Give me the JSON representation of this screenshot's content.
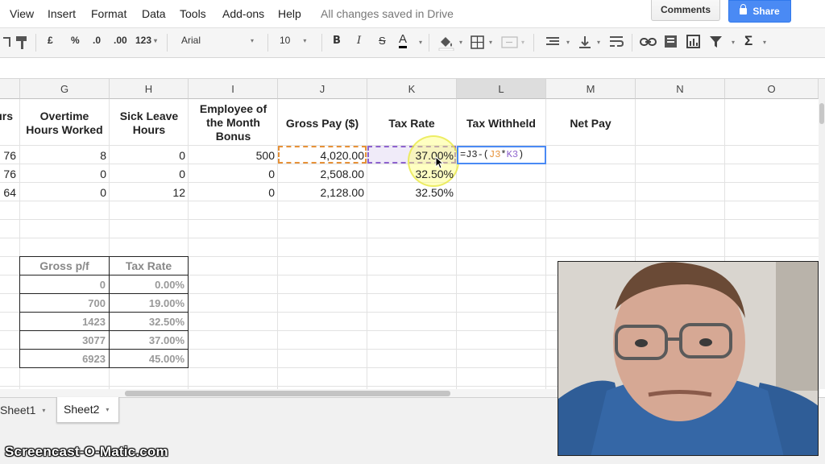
{
  "menu": {
    "items": [
      "View",
      "Insert",
      "Format",
      "Data",
      "Tools",
      "Add-ons",
      "Help"
    ],
    "status": "All changes saved in Drive",
    "comments_label": "Comments",
    "share_label": "Share"
  },
  "toolbar": {
    "currency": "£",
    "percent": "%",
    "decrease_decimal": ".0",
    "increase_decimal": ".00",
    "more_formats": "123",
    "font": "Arial",
    "font_size": "10",
    "bold": "B",
    "italic": "I",
    "strikethrough": "S",
    "text_color": "A",
    "sum": "Σ"
  },
  "grid": {
    "columns": [
      "G",
      "H",
      "I",
      "J",
      "K",
      "L",
      "M",
      "N",
      "O"
    ],
    "partial_header_left": "urs",
    "headers": {
      "overtime": "Overtime Hours Worked",
      "sick": "Sick Leave Hours",
      "eotm": "Employee of the Month Bonus",
      "gross": "Gross Pay ($)",
      "tax_rate": "Tax Rate",
      "tax_withheld": "Tax Withheld",
      "net_pay": "Net Pay"
    },
    "rows": [
      {
        "f": "76",
        "g": "8",
        "h": "0",
        "i": "500",
        "j": "4,020.00",
        "k": "37.00%"
      },
      {
        "f": "76",
        "g": "0",
        "h": "0",
        "i": "0",
        "j": "2,508.00",
        "k": "32.50%"
      },
      {
        "f": "64",
        "g": "0",
        "h": "12",
        "i": "0",
        "j": "2,128.00",
        "k": "32.50%"
      }
    ],
    "active_formula": {
      "prefix": "=J3-(",
      "ref1": "J3",
      "op": "*",
      "ref2": "K3",
      "suffix": ")"
    },
    "lookup": {
      "headers": [
        "Gross p/f",
        "Tax Rate"
      ],
      "rows": [
        [
          "0",
          "0.00%"
        ],
        [
          "700",
          "19.00%"
        ],
        [
          "1423",
          "32.50%"
        ],
        [
          "3077",
          "37.00%"
        ],
        [
          "6923",
          "45.00%"
        ]
      ]
    }
  },
  "tabs": [
    "Sheet1",
    "Sheet2"
  ],
  "watermark": "Screencast-O-Matic.com",
  "colors": {
    "share": "#4a8af4",
    "formula_ref_orange": "#e69138",
    "formula_ref_purple": "#8e63ce",
    "active_cell": "#4a8af4",
    "cursor_highlight": "#ffff66"
  }
}
